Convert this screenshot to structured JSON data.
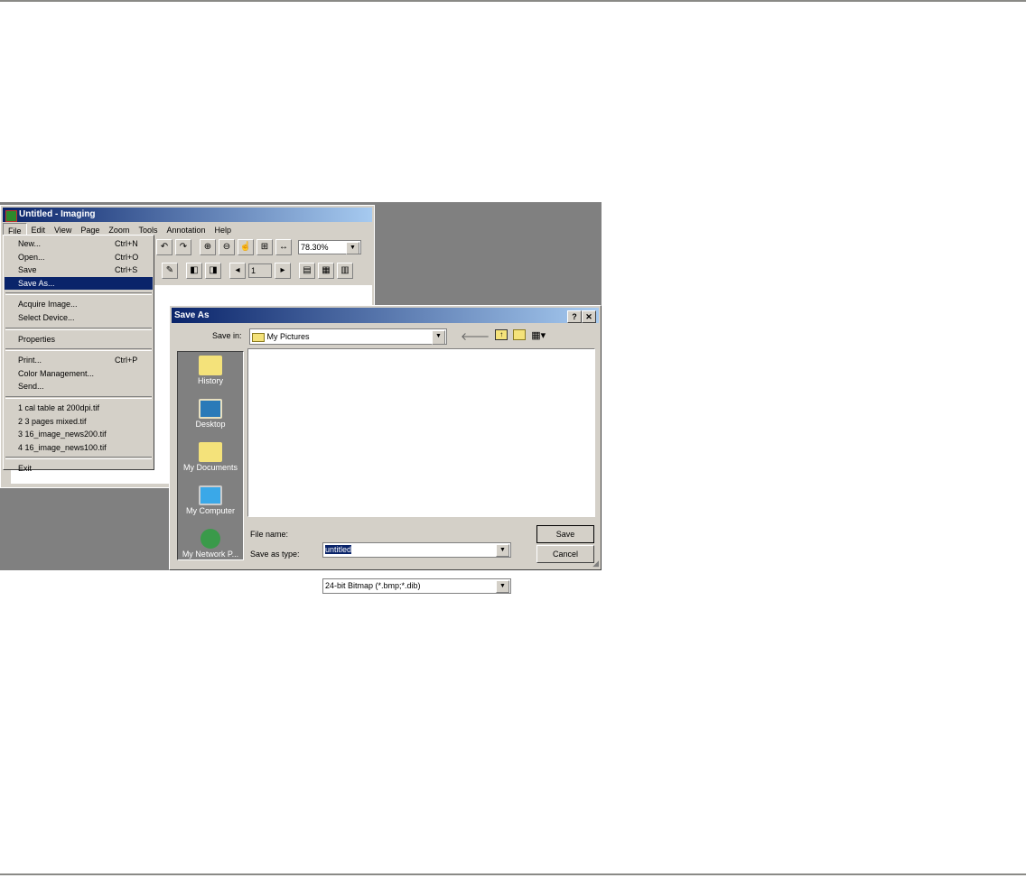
{
  "app": {
    "title": "Untitled - Imaging",
    "menus": [
      "File",
      "Edit",
      "View",
      "Page",
      "Zoom",
      "Tools",
      "Annotation",
      "Help"
    ],
    "zoom_value": "78.30%",
    "page_value": "1"
  },
  "file_menu": {
    "items": [
      {
        "label": "New...",
        "shortcut": "Ctrl+N"
      },
      {
        "label": "Open...",
        "shortcut": "Ctrl+O"
      },
      {
        "label": "Save",
        "shortcut": "Ctrl+S"
      },
      {
        "label": "Save As...",
        "shortcut": ""
      },
      {
        "label": "Acquire Image...",
        "shortcut": ""
      },
      {
        "label": "Select Device...",
        "shortcut": ""
      },
      {
        "label": "Properties",
        "shortcut": ""
      },
      {
        "label": "Print...",
        "shortcut": "Ctrl+P"
      },
      {
        "label": "Color Management...",
        "shortcut": ""
      },
      {
        "label": "Send...",
        "shortcut": ""
      },
      {
        "label": "1 cal table at 200dpi.tif",
        "shortcut": ""
      },
      {
        "label": "2 3 pages mixed.tif",
        "shortcut": ""
      },
      {
        "label": "3 16_image_news200.tif",
        "shortcut": ""
      },
      {
        "label": "4 16_image_news100.tif",
        "shortcut": ""
      },
      {
        "label": "Exit",
        "shortcut": ""
      }
    ]
  },
  "dialog": {
    "title": "Save As",
    "help": "?",
    "close": "✕",
    "save_in_label": "Save in:",
    "save_in_value": "My Pictures",
    "places": [
      "History",
      "Desktop",
      "My Documents",
      "My Computer",
      "My Network P..."
    ],
    "file_name_label": "File name:",
    "file_name_value": "untitled",
    "type_label": "Save as type:",
    "type_value": "24-bit Bitmap (*.bmp;*.dib)",
    "save_button": "Save",
    "cancel_button": "Cancel"
  }
}
